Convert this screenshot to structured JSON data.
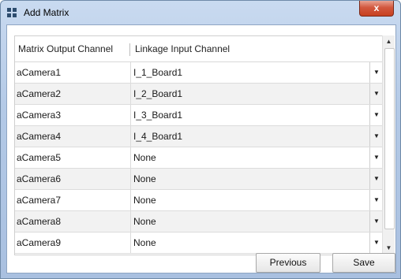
{
  "window": {
    "title": "Add Matrix",
    "close_symbol": "x"
  },
  "table": {
    "headers": [
      "Matrix Output Channel",
      "Linkage Input Channel"
    ],
    "rows": [
      {
        "output": "aCamera1",
        "input": "I_1_Board1"
      },
      {
        "output": "aCamera2",
        "input": "I_2_Board1"
      },
      {
        "output": "aCamera3",
        "input": "I_3_Board1"
      },
      {
        "output": "aCamera4",
        "input": "I_4_Board1"
      },
      {
        "output": "aCamera5",
        "input": "None"
      },
      {
        "output": "aCamera6",
        "input": "None"
      },
      {
        "output": "aCamera7",
        "input": "None"
      },
      {
        "output": "aCamera8",
        "input": "None"
      },
      {
        "output": "aCamera9",
        "input": "None"
      }
    ],
    "dropdown_symbol": "▼"
  },
  "scrollbar": {
    "up_symbol": "▲",
    "down_symbol": "▼"
  },
  "buttons": {
    "previous": "Previous",
    "save": "Save"
  }
}
